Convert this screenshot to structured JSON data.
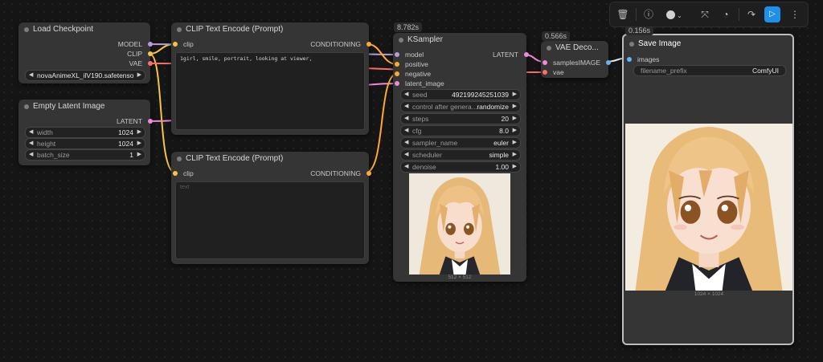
{
  "timings": {
    "ksampler": "8.782s",
    "vae_decode": "0.566s",
    "save_image": "0.156s"
  },
  "toolbar": {
    "icons": [
      "trash-icon",
      "info-icon",
      "color-circle-icon",
      "chevron-down-icon",
      "fit-view-icon",
      "pie-icon",
      "redo-icon",
      "run-icon",
      "more-icon"
    ],
    "accent": "#1f8fe8"
  },
  "load_checkpoint": {
    "title": "Load Checkpoint",
    "outputs": [
      "MODEL",
      "CLIP",
      "VAE"
    ],
    "ckpt_name": "novaAnimeXL_ilV190.safetenso..."
  },
  "empty_latent": {
    "title": "Empty Latent Image",
    "output": "LATENT",
    "widgets": [
      {
        "label": "width",
        "value": "1024"
      },
      {
        "label": "height",
        "value": "1024"
      },
      {
        "label": "batch_size",
        "value": "1"
      }
    ]
  },
  "clip_pos": {
    "title": "CLIP Text Encode (Prompt)",
    "input": "clip",
    "output": "CONDITIONING",
    "text": "1girl, smile, portrait, looking at viewer,"
  },
  "clip_neg": {
    "title": "CLIP Text Encode (Prompt)",
    "input": "clip",
    "output": "CONDITIONING",
    "placeholder": "text"
  },
  "ksampler": {
    "title": "KSampler",
    "inputs": [
      "model",
      "positive",
      "negative",
      "latent_image"
    ],
    "output": "LATENT",
    "widgets": [
      {
        "label": "seed",
        "value": "492199245251039"
      },
      {
        "label": "control after genera...",
        "value": "randomize"
      },
      {
        "label": "steps",
        "value": "20"
      },
      {
        "label": "cfg",
        "value": "8.0"
      },
      {
        "label": "sampler_name",
        "value": "euler"
      },
      {
        "label": "scheduler",
        "value": "simple"
      },
      {
        "label": "denoise",
        "value": "1.00"
      }
    ],
    "preview_dims": "512 × 512"
  },
  "vae_decode": {
    "title": "VAE Deco...",
    "inputs": [
      "samples",
      "vae"
    ],
    "output": "IMAGE"
  },
  "save_image": {
    "title": "Save Image",
    "input": "images",
    "filename_prefix_label": "filename_prefix",
    "filename_prefix_value": "ComfyUI",
    "preview_dims": "1024 × 1024"
  },
  "colors": {
    "model": "#b39ddb",
    "clip": "#f5c542",
    "vae": "#ff6b6b",
    "latent": "#f08ad8",
    "conditioning": "#ffa931",
    "image": "#64b5f6"
  }
}
